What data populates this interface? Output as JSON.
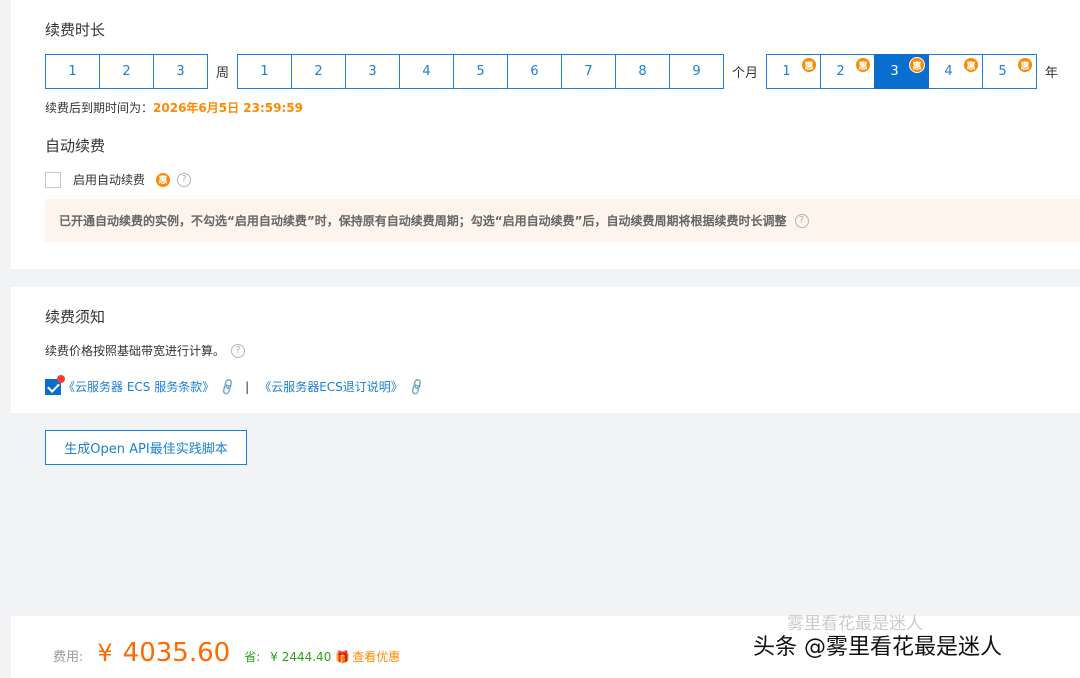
{
  "renewal": {
    "title": "续费时长",
    "weeks": [
      "1",
      "2",
      "3"
    ],
    "week_unit": "周",
    "months": [
      "1",
      "2",
      "3",
      "4",
      "5",
      "6",
      "7",
      "8",
      "9"
    ],
    "month_unit": "个月",
    "years": [
      "1",
      "2",
      "3",
      "4",
      "5"
    ],
    "year_unit": "年",
    "selected_year": "3",
    "badge": "惠",
    "expire_label": "续费后到期时间为：",
    "expire_value": "2026年6月5日 23:59:59"
  },
  "auto": {
    "title": "自动续费",
    "checkbox_label": "启用自动续费",
    "badge": "惠",
    "help": "?",
    "notice": "已开通自动续费的实例，不勾选“启用自动续费”时，保持原有自动续费周期；勾选“启用自动续费”后，自动续费周期将根据续费时长调整"
  },
  "notes": {
    "title": "续费须知",
    "tip": "续费价格按照基础带宽进行计算。",
    "help": "?",
    "link1": "《云服务器 ECS 服务条款》",
    "separator": "|",
    "link2": "《云服务器ECS退订说明》"
  },
  "api_button": "生成Open API最佳实践脚本",
  "footer": {
    "fee_label": "费用:",
    "currency": "¥",
    "amount": "4035.60",
    "save_label": "省:",
    "save_amount": "¥ 2444.40",
    "view_offer": "查看优惠"
  },
  "watermark": {
    "main": "头条 @雾里看花最是迷人",
    "faint": "雾里看花最是迷人"
  },
  "colors": {
    "accent": "#1a80d9",
    "active": "#0a6ed1",
    "price": "#ff6a00",
    "saving": "#2aa515",
    "badge": "#ff8a00"
  }
}
